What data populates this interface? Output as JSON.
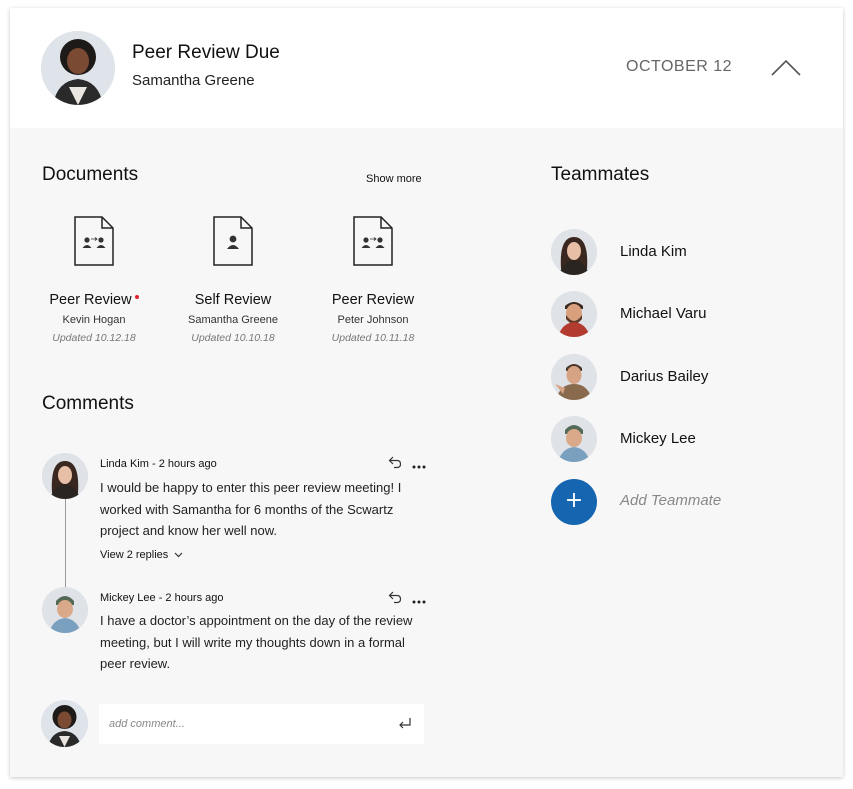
{
  "header": {
    "title": "Peer Review Due",
    "subtitle": "Samantha Greene",
    "date": "OCTOBER 12",
    "collapse_icon": "chevron-up-icon"
  },
  "documents": {
    "heading": "Documents",
    "show_more": "Show more",
    "items": [
      {
        "name": "Peer Review",
        "person": "Kevin Hogan",
        "updated": "Updated 10.12.18",
        "icon": "peer-review-file-icon",
        "unread": true
      },
      {
        "name": "Self Review",
        "person": "Samantha Greene",
        "updated": "Updated 10.10.18",
        "icon": "self-review-file-icon",
        "unread": false
      },
      {
        "name": "Peer Review",
        "person": "Peter Johnson",
        "updated": "Updated 10.11.18",
        "icon": "peer-review-file-icon",
        "unread": false
      }
    ]
  },
  "comments": {
    "heading": "Comments",
    "items": [
      {
        "author_line": "Linda Kim - 2 hours ago",
        "text": "I would be happy to enter this peer review meeting! I worked with Samantha for 6 months of the Scwartz project and know her well now.",
        "replies": "View 2 replies"
      },
      {
        "author_line": "Mickey Lee - 2 hours ago",
        "text": "I have a doctor’s appointment on the day of the review meeting, but I will write my thoughts down in a formal peer review."
      }
    ],
    "input_placeholder": "add comment..."
  },
  "teammates": {
    "heading": "Teammates",
    "members": [
      {
        "name": "Linda Kim"
      },
      {
        "name": "Michael Varu"
      },
      {
        "name": "Darius Bailey"
      },
      {
        "name": "Mickey Lee"
      }
    ],
    "add_label": "Add Teammate",
    "add_icon": "plus-icon"
  },
  "colors": {
    "accent": "#1565b0",
    "unread_dot": "#e0242c",
    "panel_bg": "#f7f7f7"
  }
}
